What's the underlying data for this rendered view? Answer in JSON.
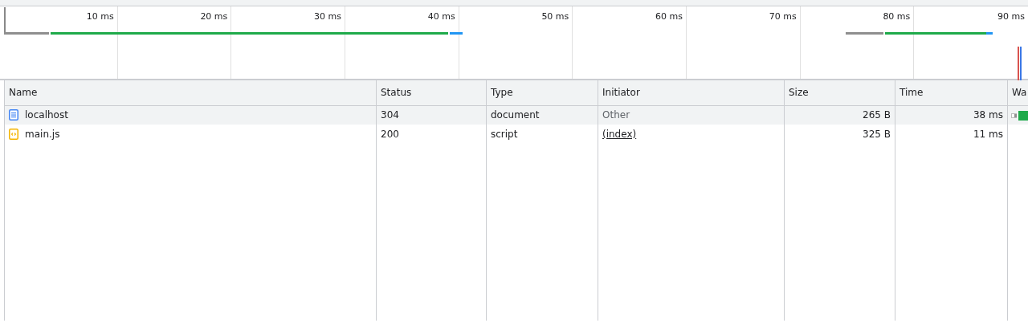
{
  "overview": {
    "ticks": [
      "10 ms",
      "20 ms",
      "30 ms",
      "40 ms",
      "50 ms",
      "60 ms",
      "70 ms",
      "80 ms",
      "90 ms"
    ]
  },
  "table": {
    "columns": [
      "Name",
      "Status",
      "Type",
      "Initiator",
      "Size",
      "Time",
      "Wa"
    ],
    "rows": [
      {
        "kind": "document",
        "name": "localhost",
        "status": "304",
        "type": "document",
        "initiator": {
          "kind": "text",
          "text": "Other"
        },
        "size": "265 B",
        "time": "38 ms",
        "selected": true,
        "waterfall": true
      },
      {
        "kind": "script",
        "name": "main.js",
        "status": "200",
        "type": "script",
        "initiator": {
          "kind": "link",
          "text": "(index)"
        },
        "size": "325 B",
        "time": "11 ms",
        "selected": false,
        "waterfall": false
      }
    ]
  }
}
